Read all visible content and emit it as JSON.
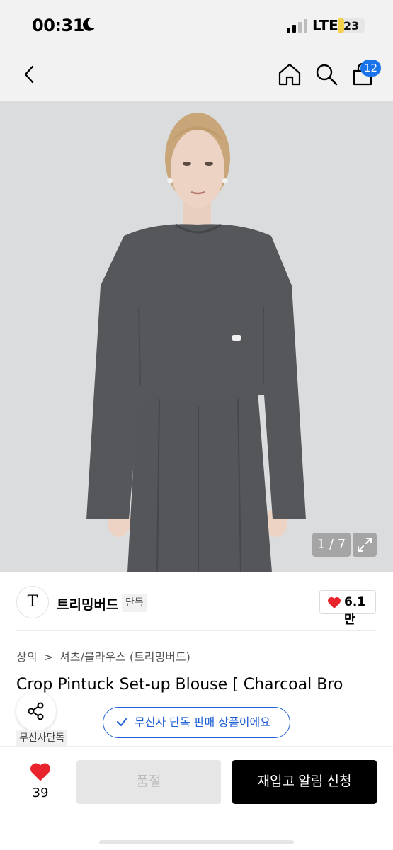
{
  "status_bar": {
    "time": "00:31",
    "network": "LTE",
    "battery_level": "23",
    "battery_fraction": 0.23,
    "icons": [
      "moon-icon",
      "signal-icon"
    ]
  },
  "nav": {
    "icons": [
      "back-icon",
      "home-icon",
      "search-icon",
      "bag-icon"
    ],
    "cart_count": "12",
    "badge_color": "#1a73e8"
  },
  "gallery": {
    "counter": "1 / 7",
    "expand_icon": "expand-icon"
  },
  "brand": {
    "logo_text": "T",
    "name": "트리밍버드",
    "tag": "단독"
  },
  "like": {
    "count": "6.1만",
    "icon": "heart-icon",
    "color": "#e8232c"
  },
  "breadcrumb": {
    "category": "상의",
    "separator": ">",
    "subcategory": "셔츠/블라우스 (트리밍버드)"
  },
  "product": {
    "title": "Crop Pintuck Set-up Blouse [ Charcoal Bro"
  },
  "share": {
    "icon": "share-icon"
  },
  "exclusive_chip": {
    "label": "무신사 단독 판매 상품이에요",
    "color": "#1f5fd6"
  },
  "store_tag": "무신사단독",
  "bottom_bar": {
    "wishlist_count": "39",
    "soldout_label": "품절",
    "restock_label": "재입고 알림 신청"
  }
}
